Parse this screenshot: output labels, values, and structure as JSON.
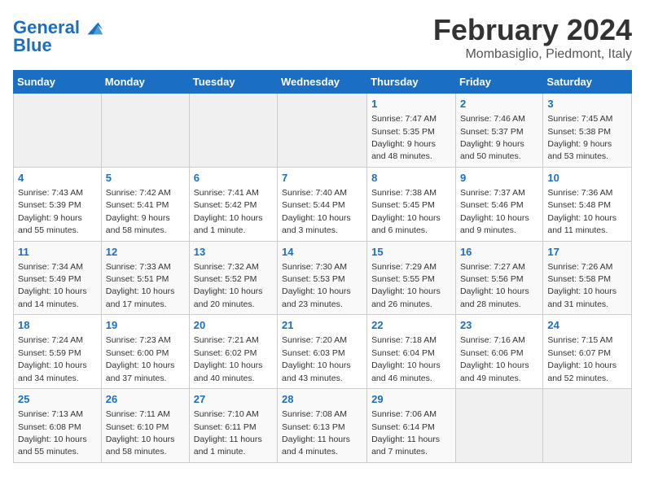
{
  "logo": {
    "line1": "General",
    "line2": "Blue"
  },
  "title": "February 2024",
  "location": "Mombasiglio, Piedmont, Italy",
  "weekdays": [
    "Sunday",
    "Monday",
    "Tuesday",
    "Wednesday",
    "Thursday",
    "Friday",
    "Saturday"
  ],
  "weeks": [
    [
      {
        "day": "",
        "detail": ""
      },
      {
        "day": "",
        "detail": ""
      },
      {
        "day": "",
        "detail": ""
      },
      {
        "day": "",
        "detail": ""
      },
      {
        "day": "1",
        "detail": "Sunrise: 7:47 AM\nSunset: 5:35 PM\nDaylight: 9 hours and 48 minutes."
      },
      {
        "day": "2",
        "detail": "Sunrise: 7:46 AM\nSunset: 5:37 PM\nDaylight: 9 hours and 50 minutes."
      },
      {
        "day": "3",
        "detail": "Sunrise: 7:45 AM\nSunset: 5:38 PM\nDaylight: 9 hours and 53 minutes."
      }
    ],
    [
      {
        "day": "4",
        "detail": "Sunrise: 7:43 AM\nSunset: 5:39 PM\nDaylight: 9 hours and 55 minutes."
      },
      {
        "day": "5",
        "detail": "Sunrise: 7:42 AM\nSunset: 5:41 PM\nDaylight: 9 hours and 58 minutes."
      },
      {
        "day": "6",
        "detail": "Sunrise: 7:41 AM\nSunset: 5:42 PM\nDaylight: 10 hours and 1 minute."
      },
      {
        "day": "7",
        "detail": "Sunrise: 7:40 AM\nSunset: 5:44 PM\nDaylight: 10 hours and 3 minutes."
      },
      {
        "day": "8",
        "detail": "Sunrise: 7:38 AM\nSunset: 5:45 PM\nDaylight: 10 hours and 6 minutes."
      },
      {
        "day": "9",
        "detail": "Sunrise: 7:37 AM\nSunset: 5:46 PM\nDaylight: 10 hours and 9 minutes."
      },
      {
        "day": "10",
        "detail": "Sunrise: 7:36 AM\nSunset: 5:48 PM\nDaylight: 10 hours and 11 minutes."
      }
    ],
    [
      {
        "day": "11",
        "detail": "Sunrise: 7:34 AM\nSunset: 5:49 PM\nDaylight: 10 hours and 14 minutes."
      },
      {
        "day": "12",
        "detail": "Sunrise: 7:33 AM\nSunset: 5:51 PM\nDaylight: 10 hours and 17 minutes."
      },
      {
        "day": "13",
        "detail": "Sunrise: 7:32 AM\nSunset: 5:52 PM\nDaylight: 10 hours and 20 minutes."
      },
      {
        "day": "14",
        "detail": "Sunrise: 7:30 AM\nSunset: 5:53 PM\nDaylight: 10 hours and 23 minutes."
      },
      {
        "day": "15",
        "detail": "Sunrise: 7:29 AM\nSunset: 5:55 PM\nDaylight: 10 hours and 26 minutes."
      },
      {
        "day": "16",
        "detail": "Sunrise: 7:27 AM\nSunset: 5:56 PM\nDaylight: 10 hours and 28 minutes."
      },
      {
        "day": "17",
        "detail": "Sunrise: 7:26 AM\nSunset: 5:58 PM\nDaylight: 10 hours and 31 minutes."
      }
    ],
    [
      {
        "day": "18",
        "detail": "Sunrise: 7:24 AM\nSunset: 5:59 PM\nDaylight: 10 hours and 34 minutes."
      },
      {
        "day": "19",
        "detail": "Sunrise: 7:23 AM\nSunset: 6:00 PM\nDaylight: 10 hours and 37 minutes."
      },
      {
        "day": "20",
        "detail": "Sunrise: 7:21 AM\nSunset: 6:02 PM\nDaylight: 10 hours and 40 minutes."
      },
      {
        "day": "21",
        "detail": "Sunrise: 7:20 AM\nSunset: 6:03 PM\nDaylight: 10 hours and 43 minutes."
      },
      {
        "day": "22",
        "detail": "Sunrise: 7:18 AM\nSunset: 6:04 PM\nDaylight: 10 hours and 46 minutes."
      },
      {
        "day": "23",
        "detail": "Sunrise: 7:16 AM\nSunset: 6:06 PM\nDaylight: 10 hours and 49 minutes."
      },
      {
        "day": "24",
        "detail": "Sunrise: 7:15 AM\nSunset: 6:07 PM\nDaylight: 10 hours and 52 minutes."
      }
    ],
    [
      {
        "day": "25",
        "detail": "Sunrise: 7:13 AM\nSunset: 6:08 PM\nDaylight: 10 hours and 55 minutes."
      },
      {
        "day": "26",
        "detail": "Sunrise: 7:11 AM\nSunset: 6:10 PM\nDaylight: 10 hours and 58 minutes."
      },
      {
        "day": "27",
        "detail": "Sunrise: 7:10 AM\nSunset: 6:11 PM\nDaylight: 11 hours and 1 minute."
      },
      {
        "day": "28",
        "detail": "Sunrise: 7:08 AM\nSunset: 6:13 PM\nDaylight: 11 hours and 4 minutes."
      },
      {
        "day": "29",
        "detail": "Sunrise: 7:06 AM\nSunset: 6:14 PM\nDaylight: 11 hours and 7 minutes."
      },
      {
        "day": "",
        "detail": ""
      },
      {
        "day": "",
        "detail": ""
      }
    ]
  ]
}
